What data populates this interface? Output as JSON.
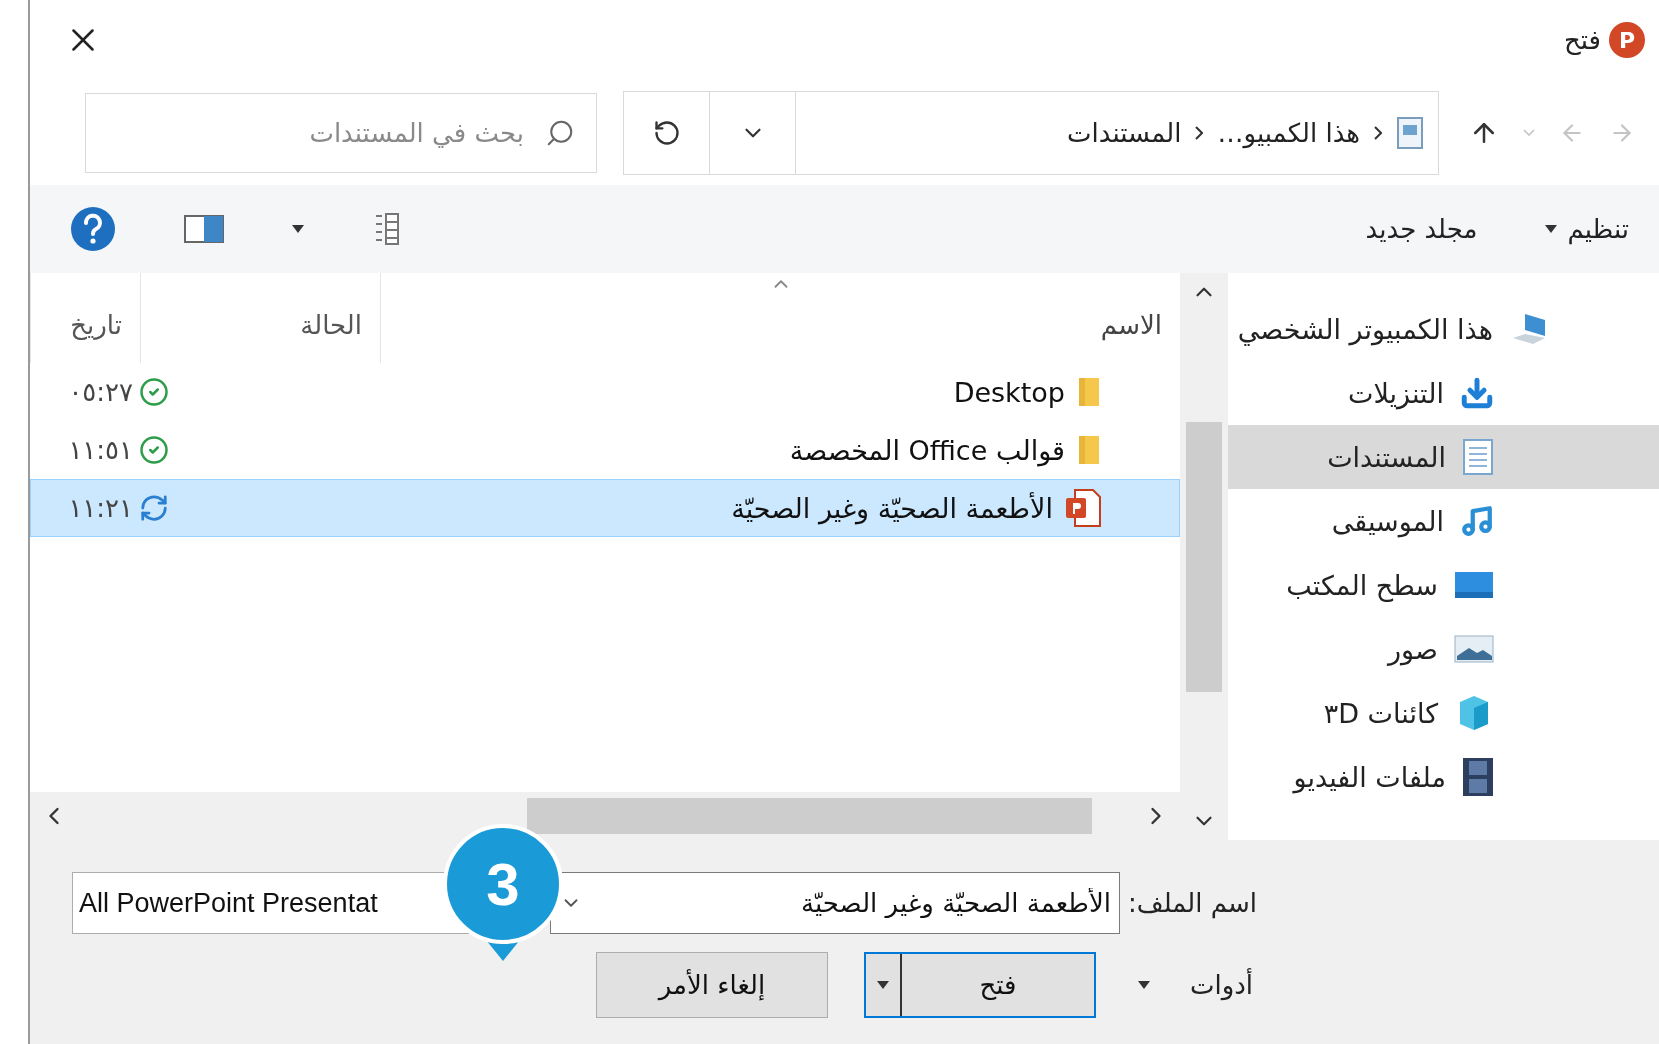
{
  "window": {
    "title": "فتح",
    "app_letter": "P"
  },
  "navigation": {
    "forward_disabled": true,
    "back_disabled": true,
    "recent_disabled": true,
    "up_disabled": false
  },
  "breadcrumb": [
    {
      "label": "هذا الكمبيو…"
    },
    {
      "label": "المستندات"
    }
  ],
  "search": {
    "placeholder": "بحث في المستندات"
  },
  "toolbar": {
    "organize": "تنظيم",
    "new_folder": "مجلد جديد"
  },
  "columns": [
    {
      "label": "الاسم",
      "sorted": true
    },
    {
      "label": "الحالة",
      "sorted": false
    },
    {
      "label": "تاريخ",
      "sorted": false
    }
  ],
  "files": [
    {
      "name": "Desktop",
      "kind": "folder",
      "synced": true,
      "date": "٠٥:٢٧",
      "selected": false
    },
    {
      "name": "قوالب Office المخصصة",
      "kind": "folder",
      "synced": true,
      "date": "١١:٥١",
      "selected": false
    },
    {
      "name": "الأطعمة الصحيّة وغير الصحيّة",
      "kind": "presentation",
      "synced": false,
      "date": "١١:٢١",
      "selected": true
    }
  ],
  "sidebar": {
    "items": [
      {
        "label": "هذا الكمبيوتر الشخصي",
        "kind": "computer",
        "selected": false
      },
      {
        "label": "التنزيلات",
        "kind": "downloads",
        "selected": false
      },
      {
        "label": "المستندات",
        "kind": "documents",
        "selected": true
      },
      {
        "label": "الموسيقى",
        "kind": "music",
        "selected": false
      },
      {
        "label": "سطح المكتب",
        "kind": "desktop",
        "selected": false
      },
      {
        "label": "صور",
        "kind": "pictures",
        "selected": false
      },
      {
        "label": "كائنات ٣D",
        "kind": "objects",
        "selected": false
      },
      {
        "label": "ملفات الفيديو",
        "kind": "videos",
        "selected": false
      }
    ]
  },
  "file_name": {
    "label": "اسم الملف:",
    "value": "الأطعمة الصحيّة وغير الصحيّة"
  },
  "file_type": {
    "value": "All PowerPoint Presentat"
  },
  "tools": "أدوات",
  "open_button": {
    "label": "فتح",
    "focused": true
  },
  "cancel_button": {
    "label": "إلغاء الأمر"
  },
  "callout": {
    "number": "3"
  }
}
